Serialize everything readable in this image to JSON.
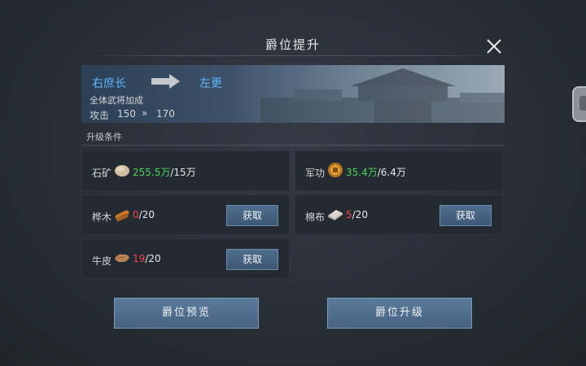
{
  "dialog": {
    "title": "爵位提升",
    "close_icon": "close-icon"
  },
  "promotion": {
    "current_rank": "右庶长",
    "next_rank": "左更",
    "bonus_label": "全体武将加成",
    "stat_name": "攻击",
    "stat_from": "150",
    "stat_sep": "»",
    "stat_to": "170"
  },
  "conditions": {
    "label": "升级条件",
    "items": [
      {
        "name": "石矿",
        "icon": "stone-ore-icon",
        "have": "255.5万",
        "need": "/15万",
        "status": "ok",
        "button": null
      },
      {
        "name": "军功",
        "icon": "military-merit-icon",
        "have": "35.4万",
        "need": "/6.4万",
        "status": "ok",
        "button": null
      },
      {
        "name": "桦木",
        "icon": "birch-wood-icon",
        "have": "0",
        "need": "/20",
        "status": "low",
        "button": "获取"
      },
      {
        "name": "棉布",
        "icon": "cotton-cloth-icon",
        "have": "5",
        "need": "/20",
        "status": "low",
        "button": "获取"
      },
      {
        "name": "牛皮",
        "icon": "cowhide-icon",
        "have": "19",
        "need": "/20",
        "status": "low",
        "button": "获取"
      }
    ]
  },
  "actions": {
    "preview": "爵位预览",
    "upgrade": "爵位升级"
  },
  "colors": {
    "rank_text": "#5fb6ff",
    "sufficient": "#4bd55c",
    "insufficient": "#f0444e",
    "button": "#46627f"
  }
}
